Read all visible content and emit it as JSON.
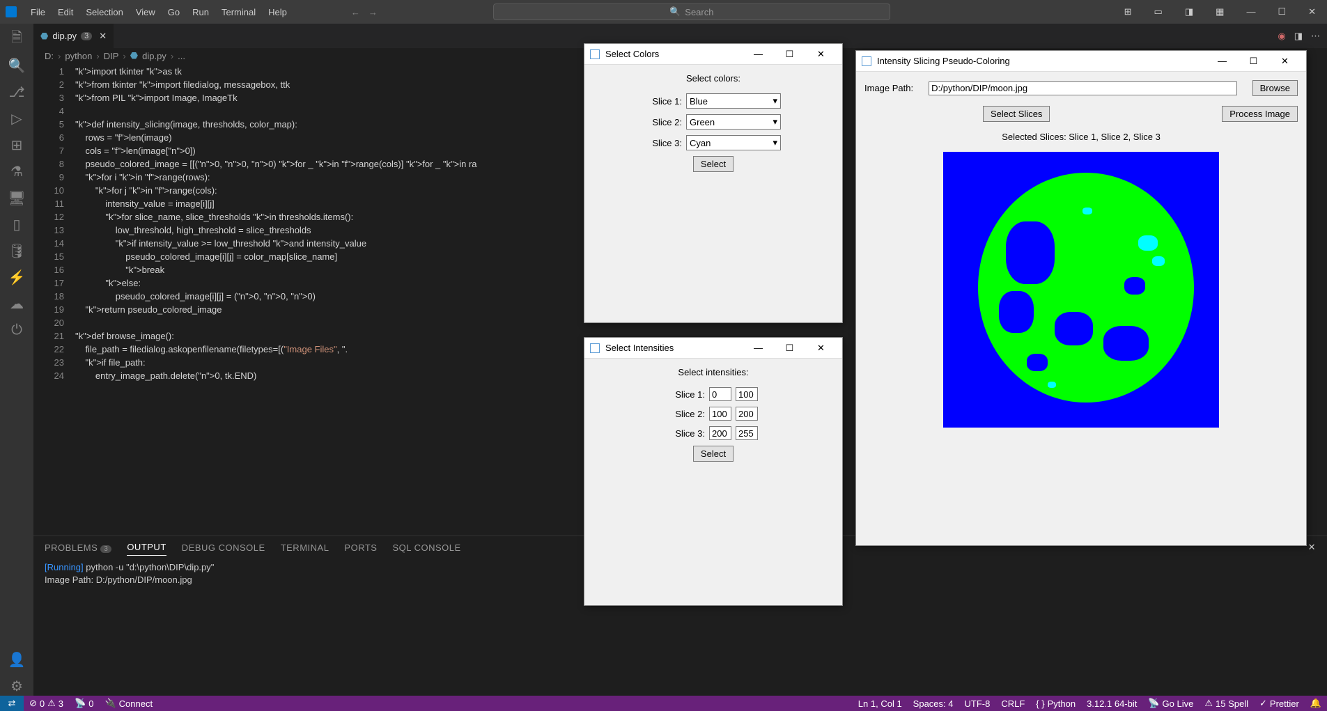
{
  "menu": {
    "file": "File",
    "edit": "Edit",
    "selection": "Selection",
    "view": "View",
    "go": "Go",
    "run": "Run",
    "terminal": "Terminal",
    "help": "Help"
  },
  "search_placeholder": "Search",
  "tab": {
    "filename": "dip.py",
    "badge": "3"
  },
  "breadcrumb": {
    "p0": "D:",
    "p1": "python",
    "p2": "DIP",
    "p3": "dip.py",
    "p4": "..."
  },
  "code_lines": [
    "import tkinter as tk",
    "from tkinter import filedialog, messagebox, ttk",
    "from PIL import Image, ImageTk",
    "",
    "def intensity_slicing(image, thresholds, color_map):",
    "    rows = len(image)",
    "    cols = len(image[0])",
    "    pseudo_colored_image = [[(0, 0, 0) for _ in range(cols)] for _ in ra",
    "    for i in range(rows):",
    "        for j in range(cols):",
    "            intensity_value = image[i][j]",
    "            for slice_name, slice_thresholds in thresholds.items():",
    "                low_threshold, high_threshold = slice_thresholds",
    "                if intensity_value >= low_threshold and intensity_value",
    "                    pseudo_colored_image[i][j] = color_map[slice_name]",
    "                    break",
    "            else:",
    "                pseudo_colored_image[i][j] = (0, 0, 0)",
    "    return pseudo_colored_image",
    "",
    "def browse_image():",
    "    file_path = filedialog.askopenfilename(filetypes=[(\"Image Files\", \".",
    "    if file_path:",
    "        entry_image_path.delete(0, tk.END)"
  ],
  "panel": {
    "problems": "PROBLEMS",
    "problems_badge": "3",
    "output": "OUTPUT",
    "debug": "DEBUG CONSOLE",
    "terminal": "TERMINAL",
    "ports": "PORTS",
    "sql": "SQL CONSOLE",
    "line1_prefix": "[Running]",
    "line1_rest": " python -u \"d:\\python\\DIP\\dip.py\"",
    "line2": "Image Path: D:/python/DIP/moon.jpg"
  },
  "status": {
    "errors": "0",
    "warnings": "3",
    "ports": "0",
    "connect": "Connect",
    "cursor": "Ln 1, Col 1",
    "spaces": "Spaces: 4",
    "encoding": "UTF-8",
    "eol": "CRLF",
    "lang": "Python",
    "version": "3.12.1 64-bit",
    "golive": "Go Live",
    "spell": "15 Spell",
    "prettier": "Prettier"
  },
  "win_colors": {
    "title": "Select Colors",
    "header": "Select colors:",
    "s1": "Slice 1:",
    "s2": "Slice 2:",
    "s3": "Slice 3:",
    "v1": "Blue",
    "v2": "Green",
    "v3": "Cyan",
    "select": "Select"
  },
  "win_int": {
    "title": "Select Intensities",
    "header": "Select intensities:",
    "s1": "Slice 1:",
    "s2": "Slice 2:",
    "s3": "Slice 3:",
    "r1a": "0",
    "r1b": "100",
    "r2a": "100",
    "r2b": "200",
    "r3a": "200",
    "r3b": "255",
    "select": "Select"
  },
  "win_main": {
    "title": "Intensity Slicing Pseudo-Coloring",
    "path_label": "Image Path:",
    "path_value": "D:/python/DIP/moon.jpg",
    "browse": "Browse",
    "slices": "Select Slices",
    "process": "Process Image",
    "selected": "Selected Slices: Slice 1, Slice 2, Slice 3"
  }
}
